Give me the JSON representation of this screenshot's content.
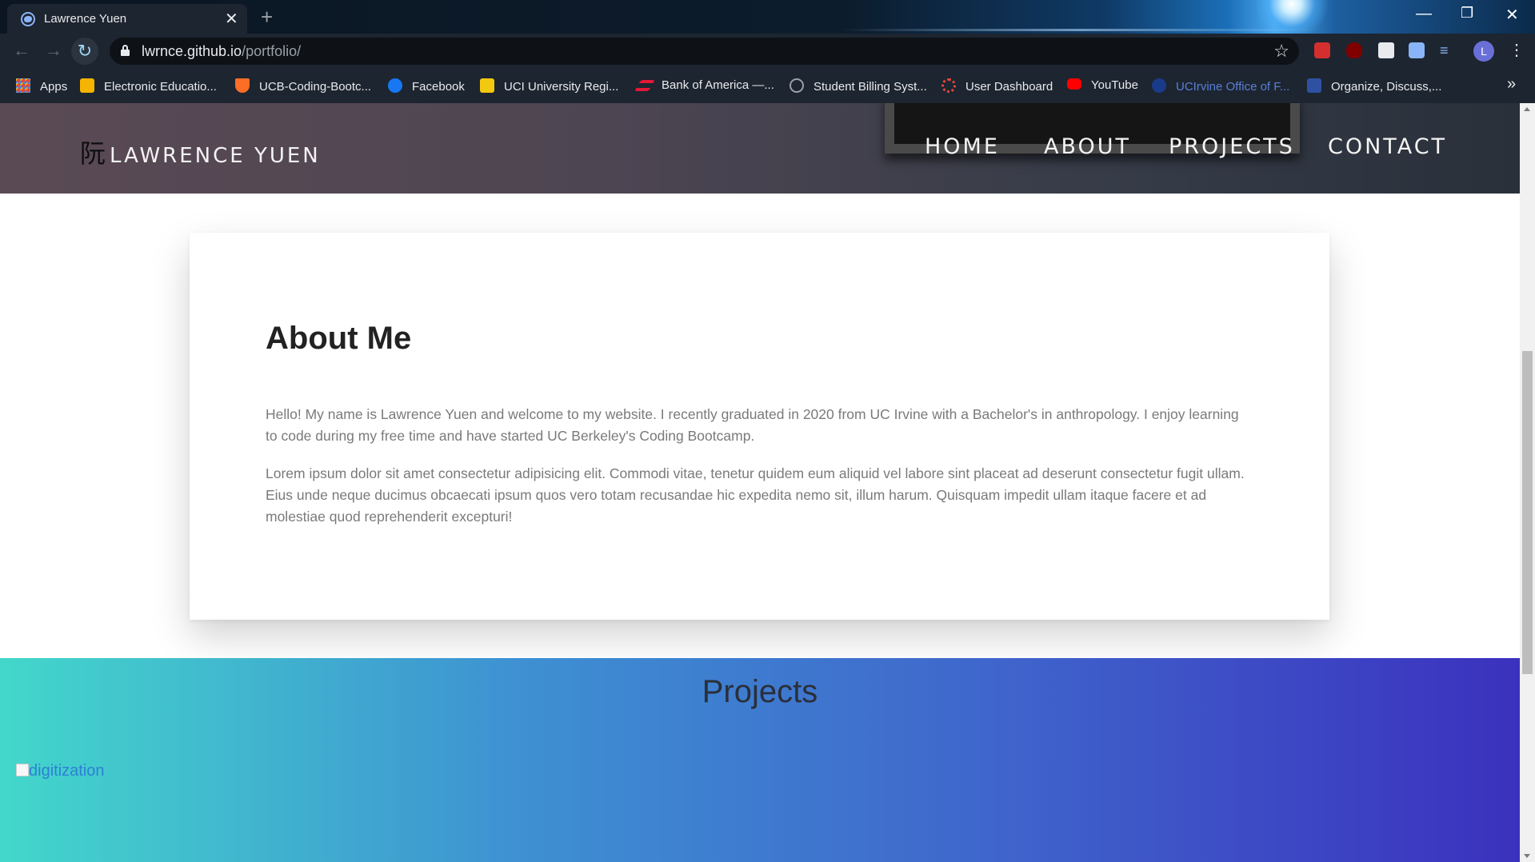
{
  "browser": {
    "tab_title": "Lawrence Yuen",
    "tab_close": "✕",
    "new_tab": "+",
    "url_host": "lwrnce.github.io",
    "url_path": "/portfolio/",
    "window_minimize": "—",
    "window_restore": "❐",
    "window_close": "✕",
    "profile_initial": "L",
    "bookmarks": [
      {
        "label": "Apps",
        "icon": "apps-grid-icon",
        "color": "#e8453c"
      },
      {
        "label": "Electronic Educatio...",
        "icon": "education-icon",
        "color": "#f5b400"
      },
      {
        "label": "UCB-Coding-Bootc...",
        "icon": "gitlab-icon",
        "color": "#fc6d26"
      },
      {
        "label": "Facebook",
        "icon": "facebook-icon",
        "color": "#1877f2"
      },
      {
        "label": "UCI University Regi...",
        "icon": "reg-icon",
        "color": "#f2c811"
      },
      {
        "label": "Bank of America —...",
        "icon": "bank-of-america-icon",
        "color": "#e31837"
      },
      {
        "label": "Student Billing Syst...",
        "icon": "globe-icon",
        "color": "#9aa0a6"
      },
      {
        "label": "User Dashboard",
        "icon": "dashboard-icon",
        "color": "#e8453c"
      },
      {
        "label": "YouTube",
        "icon": "youtube-icon",
        "color": "#ff0000"
      },
      {
        "label": "UCIrvine Office of F...",
        "icon": "uci-icon",
        "color": "#1a3a8a"
      },
      {
        "label": "Organize, Discuss,...",
        "icon": "mal-icon",
        "color": "#2e51a2"
      }
    ],
    "bookmarks_more": "»"
  },
  "site": {
    "brand_glyph": "阮",
    "brand_name": "LAWRENCE YUEN",
    "nav": [
      "HOME",
      "ABOUT",
      "PROJECTS",
      "CONTACT"
    ]
  },
  "about": {
    "heading": "About Me",
    "paragraph1": "Hello! My name is Lawrence Yuen and welcome to my website. I recently graduated in 2020 from UC Irvine with a Bachelor's in anthropology. I enjoy learning to code during my free time and have started UC Berkeley's Coding Bootcamp.",
    "paragraph2": "Lorem ipsum dolor sit amet consectetur adipisicing elit. Commodi vitae, tenetur quidem eum aliquid vel labore sint placeat ad deserunt consectetur fugit ullam. Eius unde neque ducimus obcaecati ipsum quos vero totam recusandae hic expedita nemo sit, illum harum. Quisquam impedit ullam itaque facere et ad molestiae quod reprehenderit excepturi!"
  },
  "projects": {
    "heading": "Projects",
    "image_alt": "digitization"
  },
  "colors": {
    "projects_gradient_start": "#43d7cb",
    "projects_gradient_end": "#3b31be",
    "link": "#2e7fd6"
  }
}
